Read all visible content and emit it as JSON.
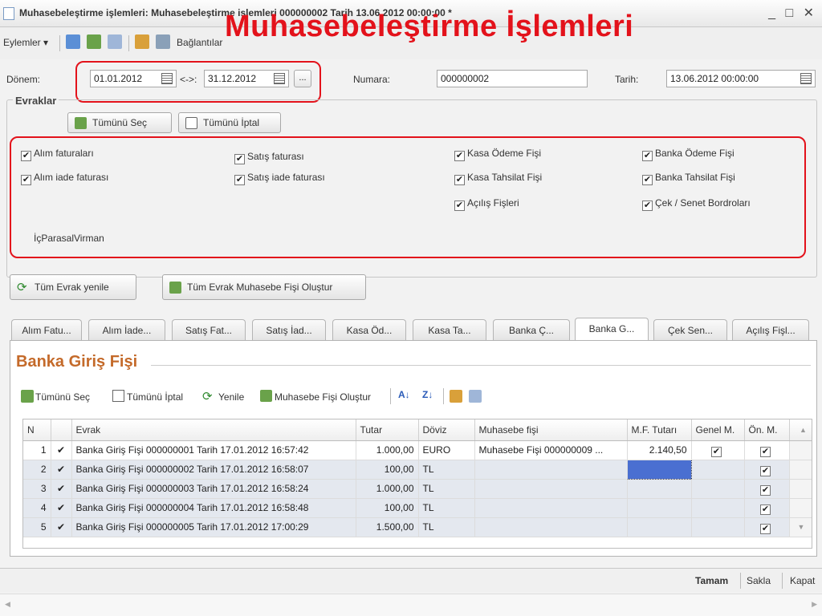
{
  "window": {
    "title": "Muhasebeleştirme işlemleri: Muhasebeleştirme işlemleri 000000002 Tarih 13.06.2012 00:00:00 *",
    "controls": "_ □ ✕"
  },
  "overlay_title": "Muhasebeleştirme İşlemleri",
  "toolbar": {
    "actions_label": "Eylemler ▾",
    "links_label": "Bağlantılar"
  },
  "header": {
    "period_label": "Dönem:",
    "date_from": "01.01.2012",
    "range_sep": "<->:",
    "date_to": "31.12.2012",
    "more_btn": "...",
    "number_label": "Numara:",
    "number_value": "000000002",
    "date_label": "Tarih:",
    "date_value": "13.06.2012 00:00:00"
  },
  "docs": {
    "legend": "Evraklar",
    "select_all": "Tümünü Seç",
    "cancel_all": "Tümünü İptal",
    "checks": [
      {
        "label": "Alım faturaları",
        "checked": "✔"
      },
      {
        "label": "Alım iade faturası",
        "checked": "✔"
      },
      {
        "label": "Satış faturası",
        "checked": "✔"
      },
      {
        "label": "Satış iade faturası",
        "checked": "✔"
      },
      {
        "label": "Kasa Ödeme Fişi",
        "checked": "✔"
      },
      {
        "label": "Kasa Tahsilat Fişi",
        "checked": "✔"
      },
      {
        "label": "Açılış Fişleri",
        "checked": "✔"
      },
      {
        "label": "Banka Ödeme Fişi",
        "checked": "✔"
      },
      {
        "label": "Banka Tahsilat Fişi",
        "checked": "✔"
      },
      {
        "label": "Çek / Senet Bordroları",
        "checked": "✔"
      }
    ],
    "internal": "İçParasalVirman"
  },
  "actions": {
    "refresh_all": "Tüm Evrak yenile",
    "create_all": "Tüm Evrak Muhasebe Fişi Oluştur"
  },
  "tabs": [
    "Alım Fatu...",
    "Alım İade...",
    "Satış Fat...",
    "Satış İad...",
    "Kasa Öd...",
    "Kasa Ta...",
    "Banka Ç...",
    "Banka G...",
    "Çek Sen...",
    "Açılış Fişl..."
  ],
  "pane": {
    "title": "Banka Giriş Fişi",
    "tb_select_all": "Tümünü Seç",
    "tb_cancel_all": "Tümünü İptal",
    "tb_refresh": "Yenile",
    "tb_create": "Muhasebe Fişi Oluştur"
  },
  "grid": {
    "headers": [
      "N",
      "",
      "Evrak",
      "Tutar",
      "Döviz",
      "Muhasebe fişi",
      "M.F. Tutarı",
      "Genel M.",
      "Ön. M."
    ],
    "rows": [
      {
        "n": "1",
        "mark": "✔",
        "doc": "Banka Giriş Fişi 000000001 Tarih 17.01.2012 16:57:42",
        "amount": "1.000,00",
        "cur": "EURO",
        "acc": "Muhasebe Fişi 000000009 ...",
        "mf": "2.140,50",
        "gen": "✔",
        "on": "✔"
      },
      {
        "n": "2",
        "mark": "✔",
        "doc": "Banka Giriş Fişi 000000002 Tarih 17.01.2012 16:58:07",
        "amount": "100,00",
        "cur": "TL",
        "acc": "",
        "mf": "",
        "gen": "",
        "on": "✔"
      },
      {
        "n": "3",
        "mark": "✔",
        "doc": "Banka Giriş Fişi 000000003 Tarih 17.01.2012 16:58:24",
        "amount": "1.000,00",
        "cur": "TL",
        "acc": "",
        "mf": "",
        "gen": "",
        "on": "✔"
      },
      {
        "n": "4",
        "mark": "✔",
        "doc": "Banka Giriş Fişi 000000004 Tarih 17.01.2012 16:58:48",
        "amount": "100,00",
        "cur": "TL",
        "acc": "",
        "mf": "",
        "gen": "",
        "on": "✔"
      },
      {
        "n": "5",
        "mark": "✔",
        "doc": "Banka Giriş Fişi 000000005 Tarih 17.01.2012 17:00:29",
        "amount": "1.500,00",
        "cur": "TL",
        "acc": "",
        "mf": "",
        "gen": "",
        "on": "✔"
      }
    ]
  },
  "footer": {
    "ok": "Tamam",
    "save": "Sakla",
    "close": "Kapat"
  },
  "colors": {
    "accent_red": "#e3121b",
    "pane_title": "#c46a2a",
    "selection": "#4a6fd1"
  }
}
